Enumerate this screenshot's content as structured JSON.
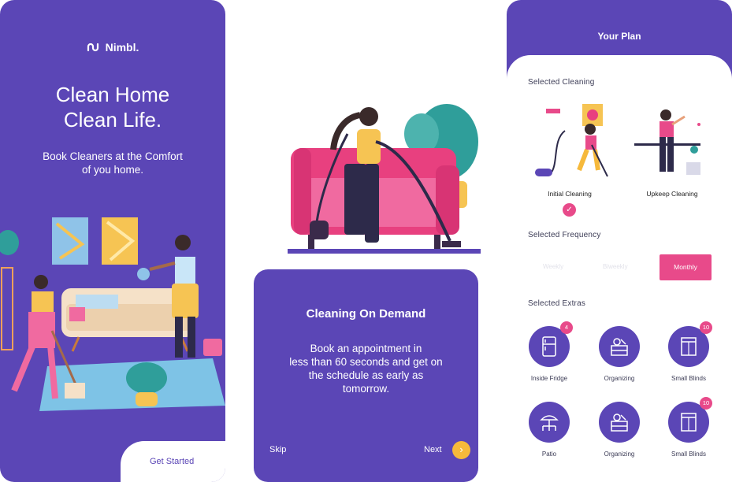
{
  "screen1": {
    "brand": "Nimbl.",
    "title_line1": "Clean Home",
    "title_line2": "Clean Life.",
    "subtitle_line1": "Book Cleaners at the Comfort",
    "subtitle_line2": "of you home.",
    "cta": "Get Started"
  },
  "screen2": {
    "title": "Cleaning On Demand",
    "body_lines": [
      "Book an appointment in",
      "less than 60 seconds and get on",
      "the schedule as early as",
      "tomorrow."
    ],
    "skip": "Skip",
    "next": "Next"
  },
  "screen3": {
    "title": "Your Plan",
    "selected_cleaning": "Selected Cleaning",
    "cleaning_options": [
      "Initial Cleaning",
      "Upkeep Cleaning"
    ],
    "selected_frequency": "Selected Frequency",
    "frequency_options": [
      "Weekly",
      "Biweekly",
      "Monthly"
    ],
    "selected_extras": "Selected Extras",
    "extras": [
      {
        "label": "Inside Fridge",
        "icon": "fridge-icon",
        "badge": "4"
      },
      {
        "label": "Organizing",
        "icon": "organizing-icon",
        "badge": ""
      },
      {
        "label": "Small Blinds",
        "icon": "blinds-icon",
        "badge": "10"
      },
      {
        "label": "Patio",
        "icon": "patio-icon",
        "badge": ""
      },
      {
        "label": "Organizing",
        "icon": "organizing-icon",
        "badge": ""
      },
      {
        "label": "Small Blinds",
        "icon": "blinds-icon",
        "badge": "10"
      }
    ]
  },
  "colors": {
    "primary": "#5b46b6",
    "accent_pink": "#e84a8a",
    "accent_yellow": "#f6b93b"
  }
}
